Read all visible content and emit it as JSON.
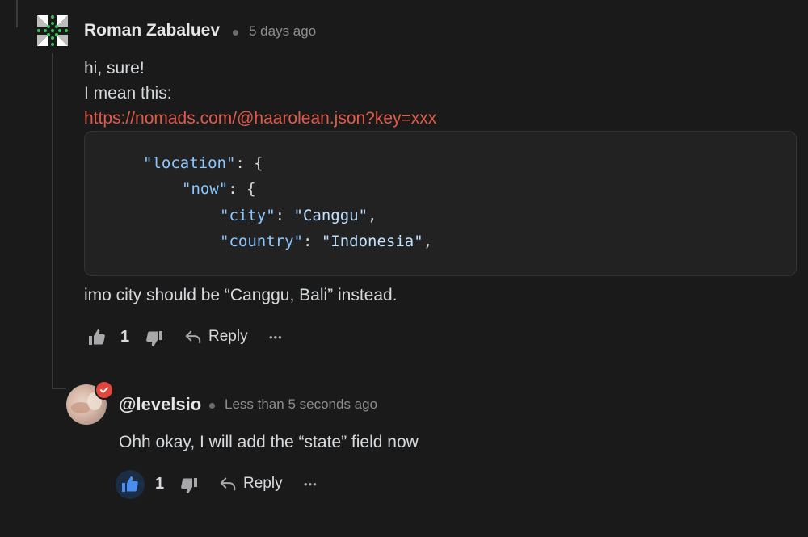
{
  "comment1": {
    "author": "Roman Zabaluev",
    "time": "5 days ago",
    "lines": [
      "hi, sure!",
      "I mean this:"
    ],
    "link": "https://nomads.com/@haarolean.json?key=xxx",
    "code": {
      "line1_key": "\"location\"",
      "line1_rest": ": {",
      "line2_key": "\"now\"",
      "line2_rest": ": {",
      "line3_key": "\"city\"",
      "line3_sep": ": ",
      "line3_val": "\"Canggu\"",
      "line3_end": ",",
      "line4_key": "\"country\"",
      "line4_sep": ": ",
      "line4_val": "\"Indonesia\"",
      "line4_end": ","
    },
    "after": "imo city should be “Canggu, Bali” instead.",
    "likes": "1",
    "reply": "Reply",
    "more": "•••"
  },
  "comment2": {
    "author": "@levelsio",
    "time": "Less than 5 seconds ago",
    "text": "Ohh okay, I will add the “state” field now",
    "likes": "1",
    "reply": "Reply",
    "more": "•••"
  },
  "colors": {
    "background": "#1a1a1b",
    "link": "#e05a4a",
    "code_key": "#8cc8ff",
    "badge": "#e2453b",
    "like_active": "#4a8ff0"
  },
  "icons": [
    "logo-icon",
    "thumbs-up-icon",
    "thumbs-down-icon",
    "reply-arrow-icon",
    "more-icon",
    "verified-badge-icon"
  ]
}
